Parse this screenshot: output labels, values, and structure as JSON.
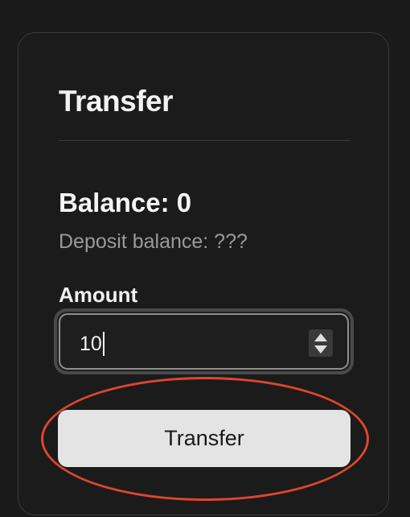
{
  "card": {
    "title": "Transfer",
    "balance_text": "Balance: 0",
    "deposit_text": "Deposit balance: ???",
    "amount_label": "Amount",
    "amount_value": "10",
    "transfer_button_label": "Transfer"
  },
  "colors": {
    "background": "#1a1a1a",
    "button_bg": "#e4e4e4",
    "highlight_ring": "#e0452e",
    "muted_text": "#9a9a9a"
  },
  "icons": {
    "stepper": "number-stepper-up-down-icon"
  }
}
